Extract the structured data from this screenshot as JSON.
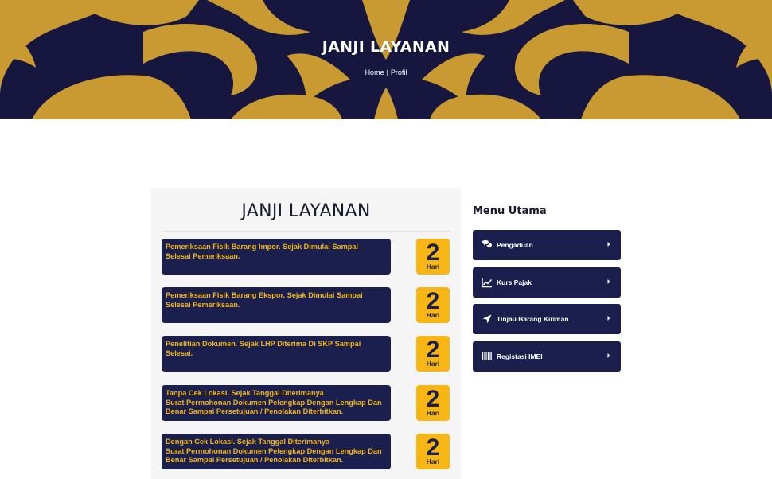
{
  "hero": {
    "title": "JANJI LAYANAN",
    "breadcrumb": {
      "home": "Home",
      "separator": "|",
      "current": "Profil"
    }
  },
  "main": {
    "title": "JANJI LAYANAN",
    "services": [
      {
        "lines": [
          "Pemeriksaan Fisik Barang Impor. Sejak Dimulai Sampai",
          "Selesai Pemeriksaan."
        ],
        "days": "2",
        "unit": "Hari"
      },
      {
        "lines": [
          "Pemeriksaan Fisik Barang Ekspor. Sejak Dimulai Sampai",
          "Selesai Pemeriksaan."
        ],
        "days": "2",
        "unit": "Hari"
      },
      {
        "lines": [
          "Penelitian Dokumen. Sejak LHP Diterima Di SKP Sampai",
          "Selesai."
        ],
        "days": "2",
        "unit": "Hari"
      },
      {
        "lines": [
          "Tanpa Cek Lokasi. Sejak Tanggal Diterimanya",
          "Surat Permohonan Dokumen Pelengkap Dengan Lengkap Dan",
          "Benar Sampai Persetujuan / Penolakan Diterbitkan."
        ],
        "days": "2",
        "unit": "Hari"
      },
      {
        "lines": [
          "Dengan Cek Lokasi. Sejak Tanggal Diterimanya",
          "Surat Permohonan Dokumen Pelengkap Dengan Lengkap Dan",
          "Benar Sampai Persetujuan / Penolakan Diterbitkan."
        ],
        "days": "2",
        "unit": "Hari"
      }
    ]
  },
  "sidebar": {
    "title": "Menu Utama",
    "items": [
      {
        "label": "Pengaduan",
        "icon": "chat-bubbles-icon"
      },
      {
        "label": "Kurs Pajak",
        "icon": "line-chart-icon"
      },
      {
        "label": "Tinjau Barang Kiriman",
        "icon": "location-arrow-icon"
      },
      {
        "label": "Registasi IMEI",
        "icon": "barcode-icon"
      }
    ]
  },
  "colors": {
    "navy": "#1a1f4d",
    "gold": "#f3b512",
    "badge": "#f7b614",
    "hero_bg": "#16163f",
    "ornament": "#c99a32"
  }
}
